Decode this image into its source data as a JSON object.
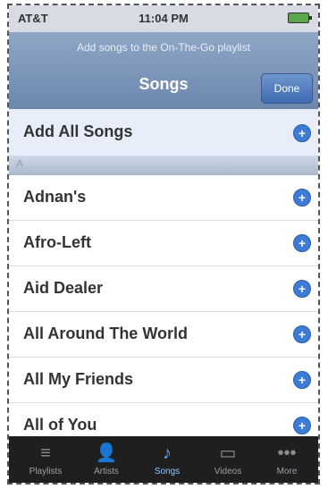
{
  "status": {
    "carrier": "AT&T",
    "time": "11:04 PM"
  },
  "navbar": {
    "prompt": "Add songs to the On-The-Go playlist",
    "title": "Songs",
    "done_label": "Done"
  },
  "add_all_label": "Add All Songs",
  "section_letter": "A",
  "songs": [
    {
      "title": "Adnan's"
    },
    {
      "title": "Afro-Left"
    },
    {
      "title": "Aid Dealer"
    },
    {
      "title": "All Around The World"
    },
    {
      "title": "All My Friends"
    },
    {
      "title": "All of You"
    }
  ],
  "tabs": [
    {
      "label": "Playlists",
      "icon": "playlists-icon",
      "active": false
    },
    {
      "label": "Artists",
      "icon": "artists-icon",
      "active": false
    },
    {
      "label": "Songs",
      "icon": "songs-icon",
      "active": true
    },
    {
      "label": "Videos",
      "icon": "videos-icon",
      "active": false
    },
    {
      "label": "More",
      "icon": "more-icon",
      "active": false
    }
  ]
}
